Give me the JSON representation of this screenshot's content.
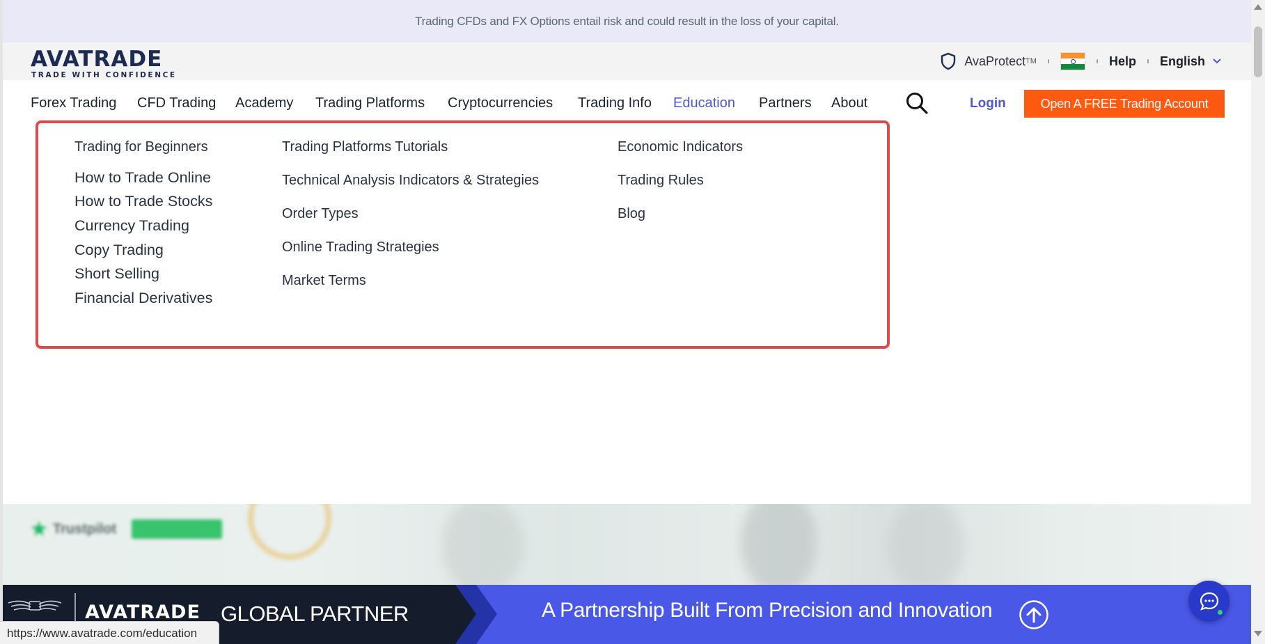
{
  "risk_banner": {
    "text": "Trading CFDs and FX Options entail risk and could result in the loss of your capital."
  },
  "header": {
    "logo_text": "AVATRADE",
    "logo_tagline": "TRADE WITH CONFIDENCE",
    "avaprotect_label": "AvaProtect",
    "avaprotect_tm": "TM",
    "help_label": "Help",
    "language_label": "English"
  },
  "nav": {
    "items": [
      {
        "label": "Forex Trading"
      },
      {
        "label": "CFD Trading"
      },
      {
        "label": "Academy"
      },
      {
        "label": "Trading Platforms"
      },
      {
        "label": "Cryptocurrencies"
      },
      {
        "label": "Trading Info"
      },
      {
        "label": "Education",
        "active": true
      },
      {
        "label": "Partners"
      },
      {
        "label": "About"
      }
    ],
    "login_label": "Login",
    "cta_label": "Open A FREE Trading Account"
  },
  "education_menu": {
    "column1": [
      "Trading for Beginners",
      "How to Trade Online",
      "How to Trade Stocks",
      "Currency Trading",
      "Copy Trading",
      "Short Selling",
      "Financial Derivatives"
    ],
    "column2": [
      "Trading Platforms Tutorials",
      "Technical Analysis Indicators & Strategies",
      "Order Types",
      "Online Trading Strategies",
      "Market Terms"
    ],
    "column3": [
      "Economic Indicators",
      "Trading Rules",
      "Blog"
    ]
  },
  "hero": {
    "trustpilot_label": "Trustpilot"
  },
  "partner_banner": {
    "logo_text": "AVATRADE",
    "global_partner": "GLOBAL PARTNER",
    "tagline": "A Partnership Built From Precision and Innovation"
  },
  "status_bar": {
    "url": "https://www.avatrade.com/education"
  },
  "colors": {
    "accent": "#4d59c7",
    "cta": "#ff5a0f",
    "highlight_border": "#e24a4a",
    "partner_blue": "#4a58e8"
  },
  "icons": [
    "shield-icon",
    "india-flag-icon",
    "chevron-down-icon",
    "search-icon",
    "arrow-up-icon",
    "chat-icon"
  ]
}
